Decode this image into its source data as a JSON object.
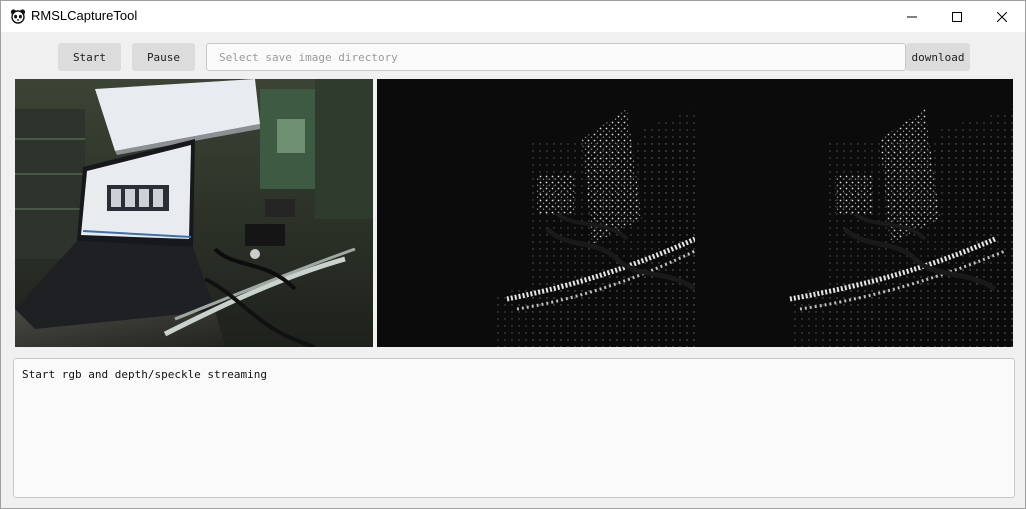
{
  "window": {
    "title": "RMSLCaptureTool",
    "app_icon": "panda-icon",
    "controls": [
      "minimize-icon",
      "maximize-icon",
      "close-icon"
    ]
  },
  "toolbar": {
    "start_label": "Start",
    "pause_label": "Pause",
    "save_dir_value": "",
    "save_dir_placeholder": "Select save image directory",
    "download_label": "download"
  },
  "views": {
    "rgb": "rgb-camera-preview",
    "depth_left": "speckle-preview-left",
    "depth_right": "speckle-preview-right"
  },
  "log": {
    "lines": [
      "Start rgb and depth/speckle streaming"
    ]
  },
  "colors": {
    "titlebar_bg": "#ffffff",
    "window_bg": "#f0f0f0",
    "button_bg": "#dcdcdc",
    "input_bg": "#fafafa",
    "depth_bg": "#0b0b0b"
  }
}
